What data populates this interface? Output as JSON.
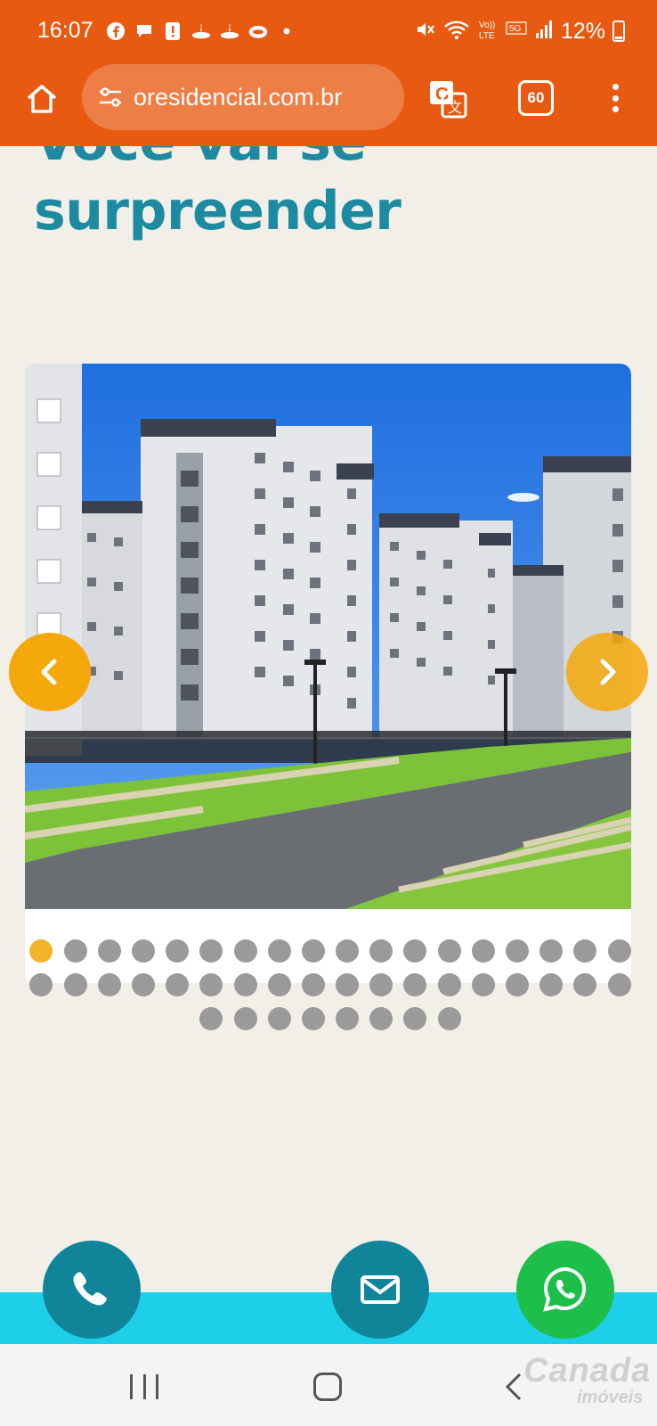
{
  "status_bar": {
    "time": "16:07",
    "battery": "12%",
    "notification_icons": [
      "facebook-icon",
      "messenger-icon",
      "alert-icon",
      "santander-icon",
      "santander-icon",
      "cloud-icon",
      "dot-icon"
    ],
    "system_icons": [
      "mute-icon",
      "wifi-icon",
      "volte-icon",
      "5g-icon",
      "signal-icon",
      "battery-icon"
    ]
  },
  "browser": {
    "url": "oresidencial.com.br",
    "tab_count": "60",
    "colors": {
      "toolbar": "#e85a12"
    }
  },
  "page": {
    "heading_line1": "Você vai se",
    "heading_line2": "surpreender",
    "heading_color": "#1c8aa1",
    "carousel": {
      "image": "apartment-buildings-photo",
      "active_slide": 1,
      "total_slides": 44,
      "prev_icon": "chevron-left-icon",
      "next_icon": "chevron-right-icon",
      "accent_color": "#f5a809"
    }
  },
  "contact_bar": {
    "phone_icon": "phone-icon",
    "email_icon": "envelope-icon",
    "whatsapp_icon": "whatsapp-icon"
  },
  "navigation": {
    "watermark": "Canada",
    "watermark_sub": "imóveis"
  }
}
